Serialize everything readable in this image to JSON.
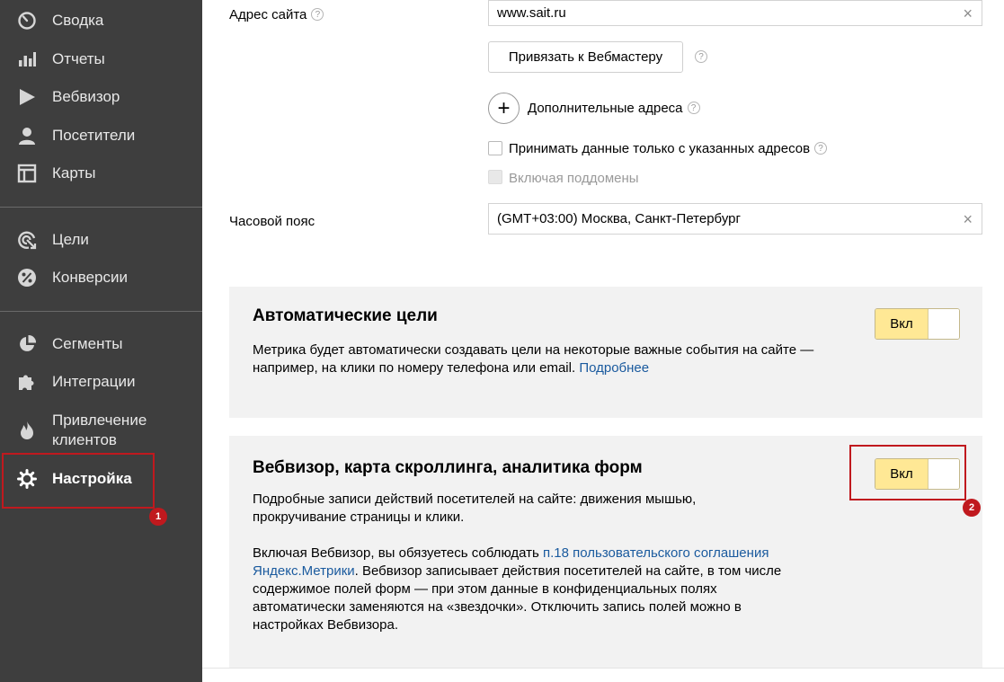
{
  "sidebar": {
    "items": [
      {
        "label": "Сводка",
        "icon": "gauge-icon"
      },
      {
        "label": "Отчеты",
        "icon": "bar-chart-icon"
      },
      {
        "label": "Вебвизор",
        "icon": "play-icon"
      },
      {
        "label": "Посетители",
        "icon": "user-icon"
      },
      {
        "label": "Карты",
        "icon": "map-layout-icon"
      },
      {
        "label": "Цели",
        "icon": "target-icon"
      },
      {
        "label": "Конверсии",
        "icon": "percent-icon"
      },
      {
        "label": "Сегменты",
        "icon": "pie-chart-icon"
      },
      {
        "label": "Интеграции",
        "icon": "puzzle-icon"
      },
      {
        "label": "Привлечение клиентов",
        "line1": "Привлечение",
        "line2": "клиентов",
        "icon": "flame-icon"
      },
      {
        "label": "Настройка",
        "icon": "gear-icon",
        "active": true
      }
    ]
  },
  "annotations": {
    "badge1": "1",
    "badge2": "2",
    "highlight_color": "#c0191e"
  },
  "form": {
    "site_address_label": "Адрес сайта",
    "site_address_value": "www.sait.ru",
    "bind_webmaster_button": "Привязать к Вебмастеру",
    "additional_addresses_label": "Дополнительные адреса",
    "accept_only_label": "Принимать данные только с указанных адресов",
    "accept_only_checked": false,
    "include_subdomains_label": "Включая поддомены",
    "include_subdomains_disabled": true,
    "timezone_label": "Часовой пояс",
    "timezone_value": "(GMT+03:00) Москва, Санкт-Петербург"
  },
  "auto_goals": {
    "title": "Автоматические цели",
    "text": "Метрика будет автоматически создавать цели на некоторые важные события на сайте — например, на клики по номеру телефона или email.",
    "link": "Подробнее",
    "toggle_label": "Вкл",
    "toggle_on": true
  },
  "webvisor": {
    "title": "Вебвизор, карта скроллинга, аналитика форм",
    "text1_line1": "Подробные записи действий посетителей на сайте: движения мышью,",
    "text1_line2": "прокручивание страницы и клики.",
    "text2_pre": "Включая Вебвизор, вы обязуетесь соблюдать ",
    "text2_link": "п.18 пользовательского соглашения Яндекс.Метрики",
    "text2_link_line1": "п.18 пользовательского соглашения",
    "text2_link_line2": "Яндекс.Метрики",
    "text2_post_line1": ". Вебвизор записывает действия посетителей на сайте, в том числе",
    "text2_post_line2": "содержимое полей форм — при этом данные в конфиденциальных полях",
    "text2_post_line3": "автоматически заменяются на «звездочки». Отключить запись полей можно в",
    "text2_post_line4": "настройках Вебвизора.",
    "toggle_label": "Вкл",
    "toggle_on": true
  },
  "help_glyph": "?",
  "clear_glyph": "×",
  "plus_glyph": "+"
}
